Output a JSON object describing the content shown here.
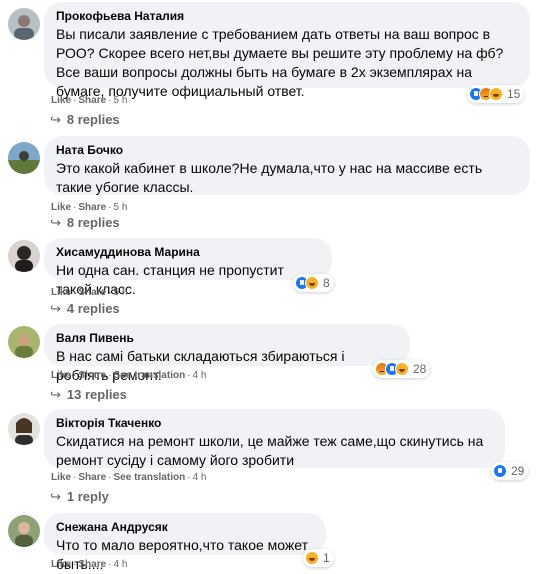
{
  "comments": [
    {
      "author": "Прокофьева Наталия",
      "text": "Вы писали заявление с требованием дать ответы на ваш вопрос в РОО? Скорее всего нет,вы думаете вы решите эту проблему на фб? Все ваши вопросы должны быть на бумаге в 2х экземплярах на бумаге, получите официальный ответ.",
      "like": "Like",
      "share": "Share",
      "time": "5 h",
      "reaction_icons": [
        "like-icon",
        "angry-icon",
        "haha-icon"
      ],
      "reaction_count": "15",
      "replies": "8 replies"
    },
    {
      "author": "Ната Бочко",
      "text": "Это какой кабинет в школе?Не думала,что у нас на массиве есть такие убогие классы.",
      "like": "Like",
      "share": "Share",
      "time": "5 h",
      "replies": "8 replies"
    },
    {
      "author": "Хисамуддинова Марина",
      "text": "Ни одна сан. станция не пропустит такой класс.",
      "like": "Like",
      "share": "Share",
      "time": "5 h",
      "reaction_icons": [
        "like-icon",
        "haha-icon"
      ],
      "reaction_count": "8",
      "replies": "4 replies"
    },
    {
      "author": "Валя Пивень",
      "text": "В нас самі батьки складаються збираються і роблять ремонт.",
      "like": "Like",
      "share": "Share",
      "see_translation": "See translation",
      "time": "4 h",
      "reaction_icons": [
        "angry-icon",
        "like-icon",
        "haha-icon"
      ],
      "reaction_count": "28",
      "replies": "13 replies"
    },
    {
      "author": "Вікторія Ткаченко",
      "text": "Скидатися на ремонт школи, це майже теж саме,що скинутись на ремонт сусіду і самому його зробити",
      "like": "Like",
      "share": "Share",
      "see_translation": "See translation",
      "time": "4 h",
      "reaction_icons": [
        "like-icon"
      ],
      "reaction_count": "29",
      "replies": "1 reply"
    },
    {
      "author": "Снежана Андрусяк",
      "text": "Что то мало вероятно,что такое может быть....",
      "like": "Like",
      "share": "Share",
      "time": "4 h",
      "reaction_icons": [
        "haha-icon"
      ],
      "reaction_count": "1"
    }
  ]
}
